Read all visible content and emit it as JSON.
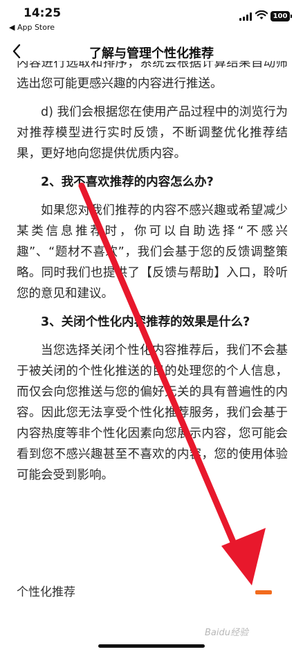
{
  "status_bar": {
    "time": "14:25",
    "back_app": "◀ App Store",
    "battery": "100"
  },
  "nav": {
    "title": "了解与管理个性化推荐",
    "back_icon": "chevron-left-icon"
  },
  "content": {
    "paragraphs": [
      "内容进行选取和排序，系统会根据计算结果自动筛选出您可能更感兴趣的内容进行推送。",
      "d) 我们会根据您在使用产品过程中的浏览行为对推荐模型进行实时反馈，不断调整优化推荐结果，更好地向您提供优质内容。",
      "2、我不喜欢推荐的内容怎么办?",
      "如果您对我们推荐的内容不感兴趣或希望减少某类信息推荐时，你可以自助选择“不感兴趣”、“题材不喜欢”，我们会基于您的反馈调整策略。同时我们也提供了【反馈与帮助】入口，聆听您的意见和建议。",
      "3、关闭个性化内容推荐的效果是什么?",
      "当您选择关闭个性化内容推荐后，我们不会基于被关闭的个性化推送的目的处理您的个人信息，而仅会向您推送与您的偏好无关的具有普遍性的内容。因此您无法享受个性化推荐服务，我们会基于内容热度等非个性化因素向您展示内容，您可能会看到您不感兴趣甚至不喜欢的内容，您的使用体验可能会受到影响。"
    ]
  },
  "footer": {
    "setting_label": "个性化推荐"
  },
  "watermark": "Baidu经验",
  "colors": {
    "accent": "#f26b1d",
    "arrow": "#e8182c"
  }
}
